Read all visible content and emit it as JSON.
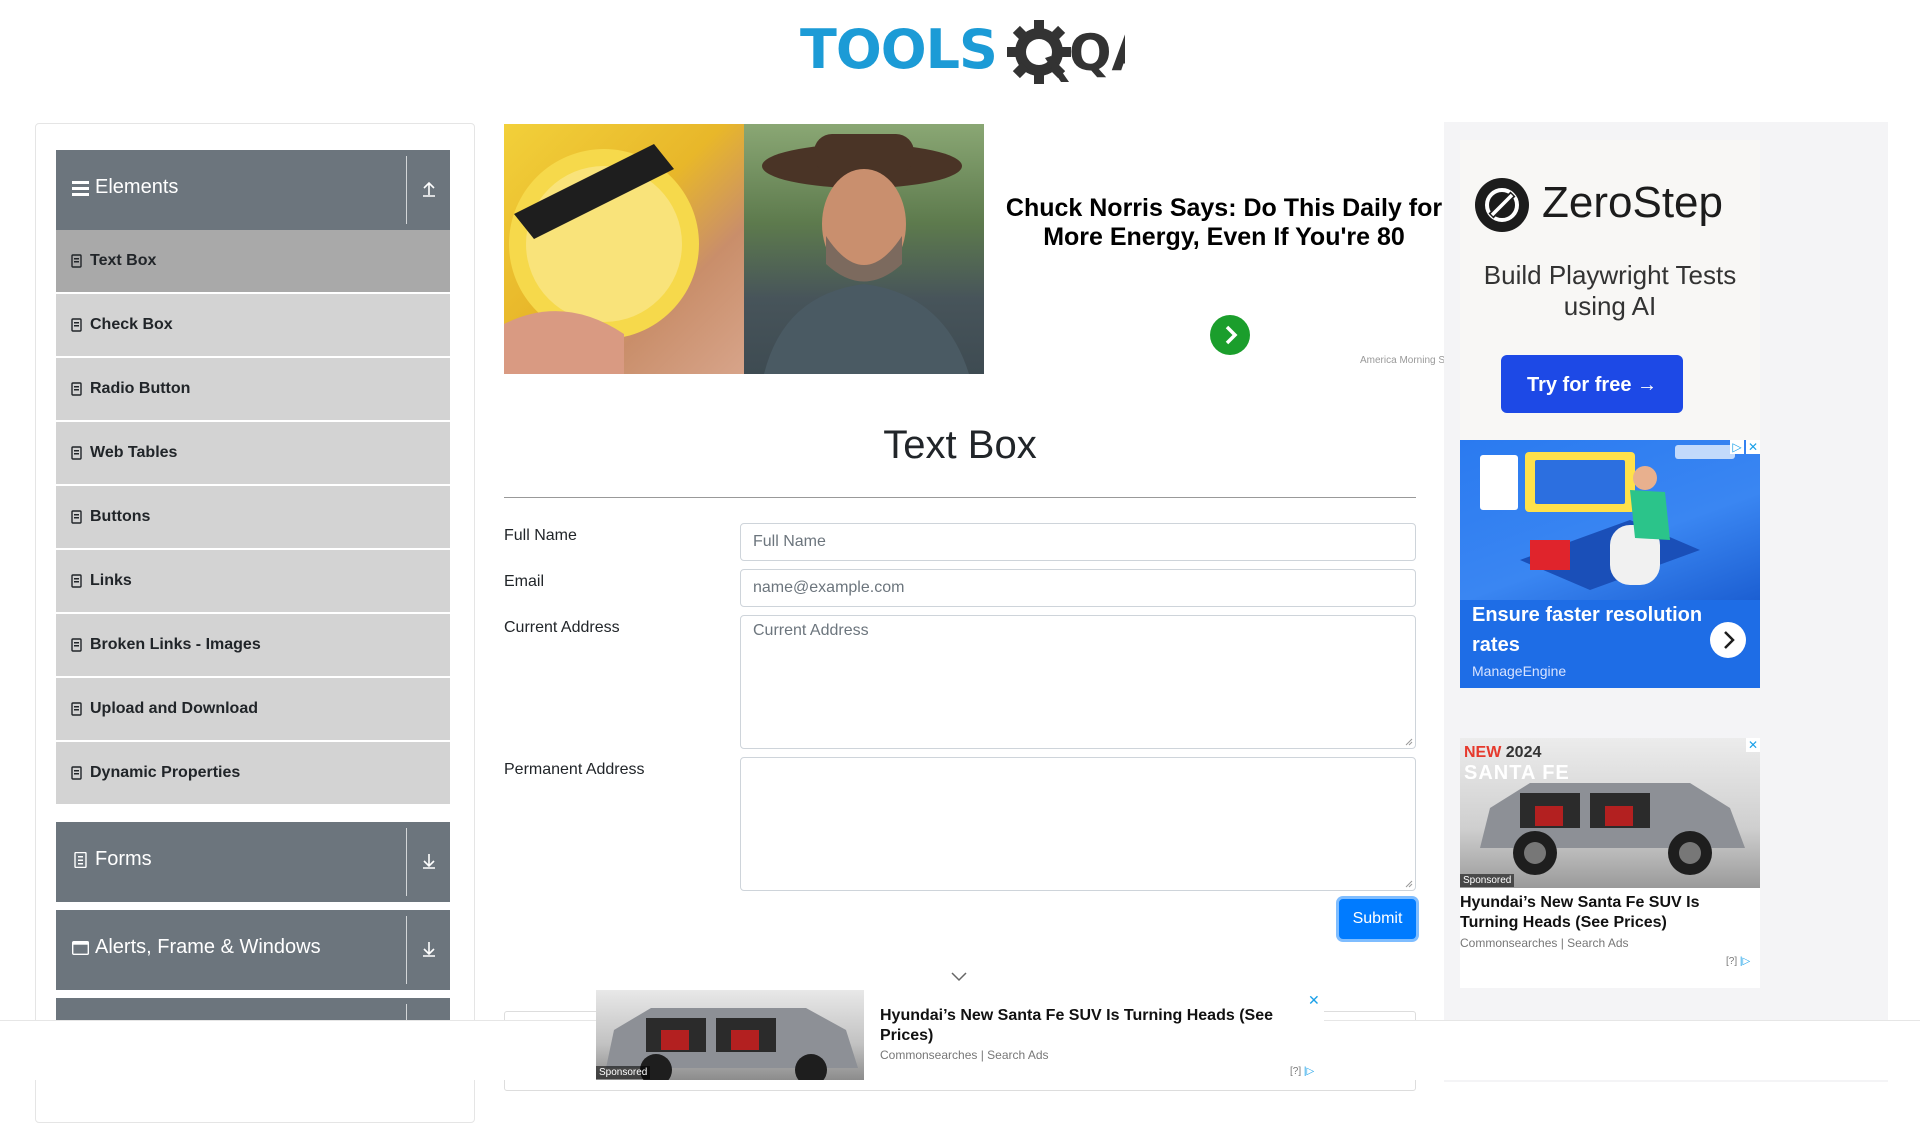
{
  "header": {
    "logo_text": "TOOLS",
    "logo_suffix": "QA"
  },
  "sidebar": {
    "groups": [
      {
        "label": "Elements",
        "icon": "list-icon",
        "expanded": true
      },
      {
        "label": "Forms",
        "icon": "document-icon",
        "expanded": false
      },
      {
        "label": "Alerts, Frame & Windows",
        "icon": "window-icon",
        "expanded": false
      }
    ],
    "items": [
      {
        "label": "Text Box",
        "active": true
      },
      {
        "label": "Check Box"
      },
      {
        "label": "Radio Button"
      },
      {
        "label": "Web Tables"
      },
      {
        "label": "Buttons"
      },
      {
        "label": "Links"
      },
      {
        "label": "Broken Links - Images"
      },
      {
        "label": "Upload and Download"
      },
      {
        "label": "Dynamic Properties"
      }
    ]
  },
  "top_ad": {
    "headline": "Chuck Norris Says: Do This Daily for More Energy, Even If You're 80",
    "source": "America Morning S"
  },
  "main": {
    "title": "Text Box",
    "full_name": {
      "label": "Full Name",
      "placeholder": "Full Name",
      "value": ""
    },
    "email": {
      "label": "Email",
      "placeholder": "name@example.com",
      "value": ""
    },
    "current_address": {
      "label": "Current Address",
      "placeholder": "Current Address",
      "value": ""
    },
    "permanent_address": {
      "label": "Permanent Address",
      "placeholder": "",
      "value": ""
    },
    "submit_label": "Submit"
  },
  "right_ads": {
    "zerostep": {
      "brand": "ZeroStep",
      "tagline": "Build Playwright Tests using AI",
      "cta": "Try for free →"
    },
    "manageengine": {
      "headline": "Ensure faster resolution rates",
      "brand": "ManageEngine"
    },
    "hyundai": {
      "badge_new": "NEW",
      "badge_year": "2024",
      "badge_model": "SANTA FE",
      "sponsored": "Sponsored",
      "headline": "Hyundai’s New Santa Fe SUV Is Turning Heads (See Prices)",
      "source": "Commonsearches | Search Ads",
      "info": "[?]"
    }
  },
  "bottom_ad": {
    "sponsored": "Sponsored",
    "headline": "Hyundai’s New Santa Fe SUV Is Turning Heads (See Prices)",
    "source": "Commonsearches | Search Ads",
    "info": "[?]",
    "close": "✕"
  },
  "colors": {
    "brand_blue": "#1c9bd6",
    "sidebar_header": "#6c757d",
    "sidebar_item": "#d3d3d3",
    "sidebar_item_active": "#a9a9a9",
    "primary_button": "#007bff"
  }
}
